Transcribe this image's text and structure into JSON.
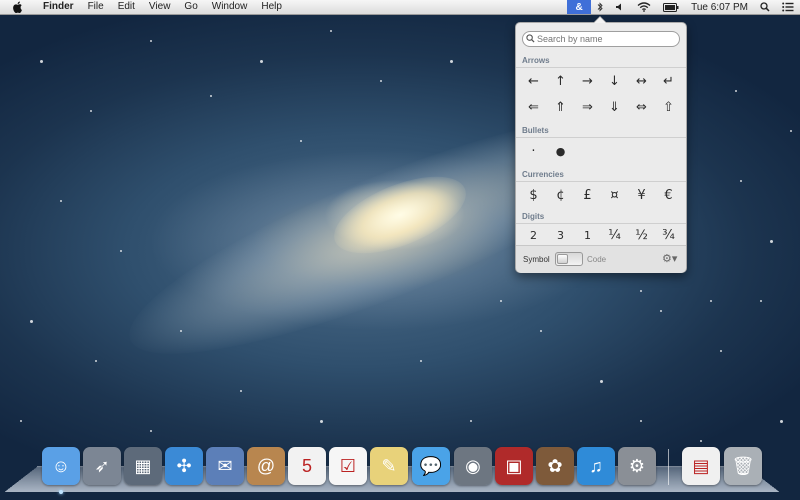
{
  "menubar": {
    "apple_icon": "apple-icon",
    "app_name": "Finder",
    "menus": [
      "File",
      "Edit",
      "View",
      "Go",
      "Window",
      "Help"
    ],
    "status": {
      "character_viewer_icon": "&",
      "clock": "Tue 6:07 PM"
    }
  },
  "character_viewer": {
    "search": {
      "placeholder": "Search by name"
    },
    "sections": {
      "arrows": {
        "title": "Arrows",
        "chars": [
          "←",
          "↑",
          "→",
          "↓",
          "↔",
          "↵",
          "⇐",
          "⇑",
          "⇒",
          "⇓",
          "⇔",
          "⇧"
        ]
      },
      "bullets": {
        "title": "Bullets",
        "chars": [
          "·",
          "●"
        ]
      },
      "currencies": {
        "title": "Currencies",
        "chars": [
          "$",
          "¢",
          "£",
          "¤",
          "¥",
          "€"
        ]
      },
      "digits": {
        "title": "Digits",
        "chars": [
          "2",
          "3",
          "1",
          "¼",
          "½",
          "¾"
        ]
      }
    },
    "footer": {
      "symbol_label": "Symbol",
      "code_label": "Code",
      "toggle_state": "symbol"
    }
  },
  "dock": {
    "items": [
      {
        "name": "finder",
        "icon": "finder-icon",
        "color": "#5aa0e6",
        "glyph": "☺",
        "running": true
      },
      {
        "name": "launchpad",
        "icon": "launchpad-icon",
        "color": "#7c8694",
        "glyph": "➶",
        "running": false
      },
      {
        "name": "mission-control",
        "icon": "mission-control-icon",
        "color": "#5d6a7a",
        "glyph": "▦",
        "running": false
      },
      {
        "name": "safari",
        "icon": "safari-icon",
        "color": "#3b8ad6",
        "glyph": "✣",
        "running": false
      },
      {
        "name": "mail",
        "icon": "mail-icon",
        "color": "#5c7fb8",
        "glyph": "✉",
        "running": false
      },
      {
        "name": "contacts",
        "icon": "contacts-icon",
        "color": "#b8864f",
        "glyph": "@",
        "running": false
      },
      {
        "name": "calendar",
        "icon": "calendar-icon",
        "color": "#f2f2f2",
        "glyph": "5",
        "running": false
      },
      {
        "name": "reminders",
        "icon": "reminders-icon",
        "color": "#f6f6f6",
        "glyph": "☑",
        "running": false
      },
      {
        "name": "notes",
        "icon": "notes-icon",
        "color": "#e8d27a",
        "glyph": "✎",
        "running": false
      },
      {
        "name": "messages",
        "icon": "messages-icon",
        "color": "#4aa3e8",
        "glyph": "💬",
        "running": false
      },
      {
        "name": "facetime",
        "icon": "facetime-icon",
        "color": "#6d7681",
        "glyph": "◉",
        "running": false
      },
      {
        "name": "photo-booth",
        "icon": "photo-booth-icon",
        "color": "#b02a2a",
        "glyph": "▣",
        "running": false
      },
      {
        "name": "iphoto",
        "icon": "iphoto-icon",
        "color": "#7e5a3a",
        "glyph": "✿",
        "running": false
      },
      {
        "name": "itunes",
        "icon": "itunes-icon",
        "color": "#2f8bd8",
        "glyph": "♫",
        "running": false
      },
      {
        "name": "system-preferences",
        "icon": "system-preferences-icon",
        "color": "#8a8f96",
        "glyph": "⚙",
        "running": false
      },
      {
        "name": "document",
        "icon": "document-icon",
        "color": "#f0f0f0",
        "glyph": "▤",
        "running": false
      },
      {
        "name": "trash",
        "icon": "trash-icon",
        "color": "#aab0b6",
        "glyph": "🗑",
        "running": false
      }
    ]
  }
}
